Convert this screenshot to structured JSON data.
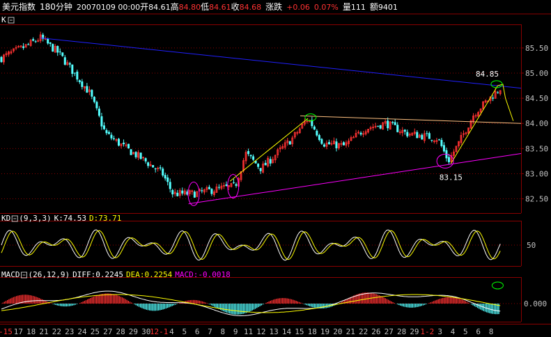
{
  "header": {
    "symbol": "美元指数",
    "period": "180分钟",
    "datetime": "20070109 00:00",
    "open_label": "开",
    "open": "84.61",
    "high_label": "高",
    "high": "84.80",
    "low_label": "低",
    "low": "84.61",
    "close_label": "收",
    "close": "84.68",
    "change_label": "涨跌",
    "change": "+0.06",
    "change_pct": "0.07%",
    "volume_label": "量",
    "volume": "111",
    "amount_label": "额",
    "amount": "9401"
  },
  "colors": {
    "up": "#ff3232",
    "down": "#54ffff",
    "grid": "#8b0000",
    "axis_text": "#c0c0c0",
    "k_line": "#ffffff",
    "d_line": "#ffff00",
    "diff_line": "#ffffff",
    "dea_line": "#ffff00",
    "macd_text": "#ff00ff",
    "trend_top": "#2020ff",
    "trend_bottom": "#ff00ff",
    "trend_mid": "#ffc080",
    "yellow": "#ffff00",
    "ellipse_green": "#00ff00"
  },
  "main_panel": {
    "label": "K",
    "icon": "minus-box-icon"
  },
  "kd_panel": {
    "label": "KD",
    "params": "(9,3,3)",
    "k_label": "K:",
    "k_value": "74.53",
    "d_label": "D:",
    "d_value": "73.71",
    "axis_label": "50"
  },
  "macd_panel": {
    "label": "MACD",
    "params": "(26,12,9)",
    "diff_label": "DIFF:",
    "diff_value": "0.2245",
    "dea_label": "DEA:",
    "dea_value": "0.2254",
    "macd_label": "MACD:",
    "macd_value": "-0.0018",
    "axis_label": "0.000"
  },
  "chart_data": {
    "type": "candlestick",
    "y_ticks": [
      "85.50",
      "85.00",
      "84.50",
      "84.00",
      "83.50",
      "83.00",
      "82.50"
    ],
    "ylim": [
      82.3,
      85.9
    ],
    "annotations": [
      {
        "label": "84.85",
        "value": 84.85
      },
      {
        "label": "83.15",
        "value": 83.15
      }
    ],
    "x_ticks": [
      "-15",
      "17",
      "18",
      "21",
      "22",
      "23",
      "24",
      "25",
      "27",
      "28",
      "29",
      "30",
      "12-1",
      "4",
      "5",
      "6",
      "7",
      "8",
      "9",
      "11",
      "12",
      "13",
      "14",
      "15",
      "18",
      "19",
      "20",
      "21",
      "22",
      "26",
      "27",
      "28",
      "29",
      "1-2",
      "3",
      "4",
      "5",
      "6",
      "8"
    ],
    "price_path": [
      {
        "t": 0,
        "p": 85.3
      },
      {
        "t": 0.05,
        "p": 85.55
      },
      {
        "t": 0.075,
        "p": 85.7
      },
      {
        "t": 0.11,
        "p": 85.4
      },
      {
        "t": 0.14,
        "p": 85.0
      },
      {
        "t": 0.17,
        "p": 84.6
      },
      {
        "t": 0.2,
        "p": 83.8
      },
      {
        "t": 0.24,
        "p": 83.5
      },
      {
        "t": 0.27,
        "p": 83.3
      },
      {
        "t": 0.31,
        "p": 83.0
      },
      {
        "t": 0.33,
        "p": 82.6
      },
      {
        "t": 0.37,
        "p": 82.6
      },
      {
        "t": 0.42,
        "p": 82.7
      },
      {
        "t": 0.45,
        "p": 82.75
      },
      {
        "t": 0.47,
        "p": 83.4
      },
      {
        "t": 0.5,
        "p": 83.1
      },
      {
        "t": 0.53,
        "p": 83.4
      },
      {
        "t": 0.56,
        "p": 83.7
      },
      {
        "t": 0.59,
        "p": 84.1
      },
      {
        "t": 0.62,
        "p": 83.6
      },
      {
        "t": 0.66,
        "p": 83.55
      },
      {
        "t": 0.7,
        "p": 83.9
      },
      {
        "t": 0.74,
        "p": 84.0
      },
      {
        "t": 0.78,
        "p": 83.8
      },
      {
        "t": 0.84,
        "p": 83.7
      },
      {
        "t": 0.86,
        "p": 83.25
      },
      {
        "t": 0.88,
        "p": 83.6
      },
      {
        "t": 0.91,
        "p": 84.2
      },
      {
        "t": 0.94,
        "p": 84.5
      },
      {
        "t": 0.96,
        "p": 84.7
      }
    ],
    "trend_lines": [
      {
        "name": "resistance",
        "from": {
          "t": 0.075,
          "p": 85.7
        },
        "to": {
          "t": 1.0,
          "p": 84.7
        }
      },
      {
        "name": "support",
        "from": {
          "t": 0.36,
          "p": 82.4
        },
        "to": {
          "t": 1.0,
          "p": 83.4
        }
      },
      {
        "name": "neckline",
        "from": {
          "t": 0.575,
          "p": 84.15
        },
        "to": {
          "t": 1.0,
          "p": 84.0
        }
      }
    ]
  }
}
